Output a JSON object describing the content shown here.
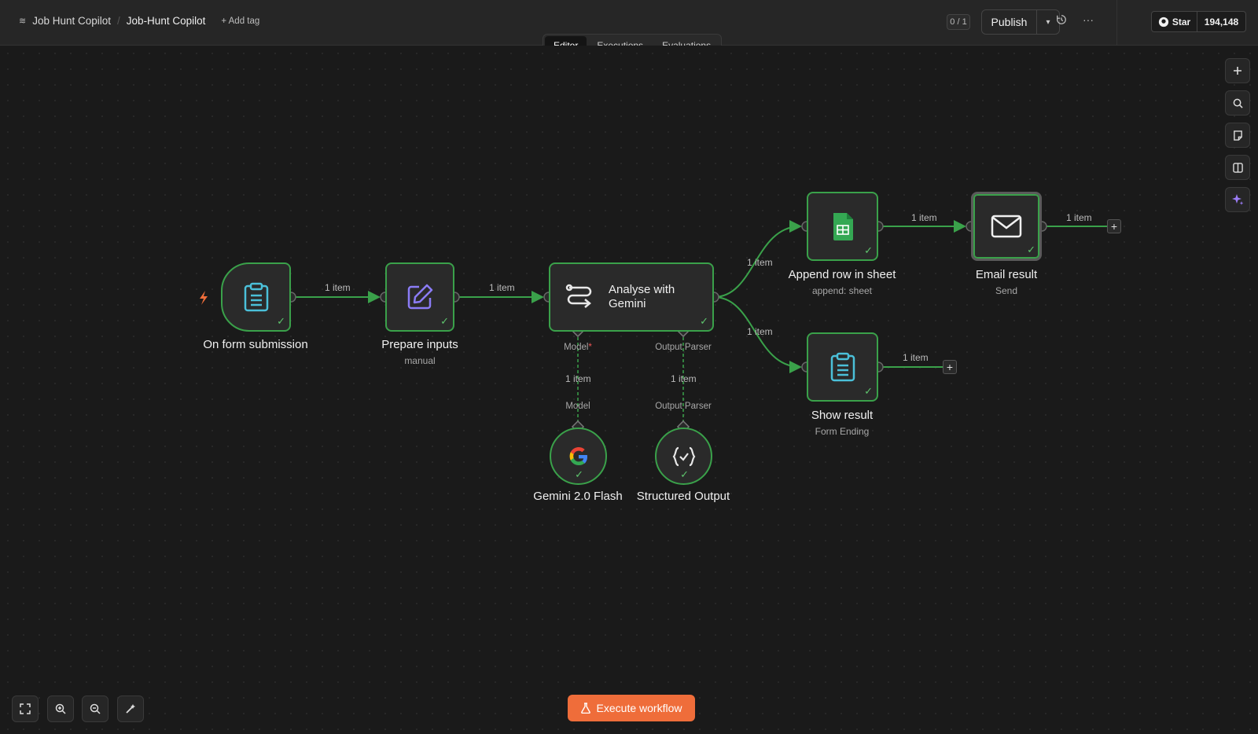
{
  "header": {
    "project": "Job Hunt Copilot",
    "workflow_title": "Job-Hunt Copilot",
    "add_tag": "+ Add tag",
    "counter": "0 / 1",
    "publish": "Publish",
    "github_star": "Star",
    "github_count": "194,148"
  },
  "tabs": [
    "Editor",
    "Executions",
    "Evaluations"
  ],
  "active_tab": "Editor",
  "nodes": {
    "form": {
      "label": "On form submission",
      "icon": "clipboard-icon"
    },
    "prepare": {
      "label": "Prepare inputs",
      "sub": "manual",
      "icon": "edit-icon"
    },
    "analyse": {
      "label": "Analyse with Gemini",
      "icon": "agent-icon",
      "port_model": "Model",
      "port_parser": "Output Parser"
    },
    "sheet": {
      "label": "Append row in sheet",
      "sub": "append: sheet",
      "icon": "google-sheets-icon"
    },
    "email": {
      "label": "Email result",
      "sub": "Send",
      "icon": "envelope-icon"
    },
    "show": {
      "label": "Show result",
      "sub": "Form Ending",
      "icon": "clipboard-icon"
    },
    "gemini": {
      "label": "Gemini 2.0 Flash",
      "port": "Model",
      "icon": "google-icon"
    },
    "structured": {
      "label": "Structured Output",
      "port": "Output Parser",
      "icon": "braces-check-icon"
    }
  },
  "edges": {
    "item_label": "1 item"
  },
  "execute_button": "Execute workflow",
  "colors": {
    "accent": "#ef6d3a",
    "success": "#3aa14a",
    "canvas": "#1a1a1a"
  }
}
